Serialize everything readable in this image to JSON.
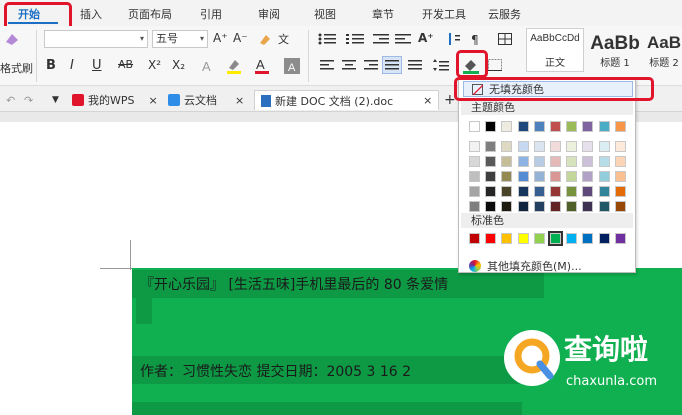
{
  "menu": {
    "tabs": [
      "开始",
      "插入",
      "页面布局",
      "引用",
      "审阅",
      "视图",
      "章节",
      "开发工具",
      "云服务"
    ],
    "active_tab": "开始"
  },
  "ribbon": {
    "format_painter_label": "格式刷",
    "font_size": "五号",
    "font_size_caret": "▾",
    "font_grow": "A⁺",
    "font_shrink": "A⁻",
    "bold": "B",
    "italic": "I",
    "underline": "U",
    "strikethrough": "AB",
    "superscript": "X²",
    "subscript": "X₂",
    "phonetic": "文",
    "styles": [
      {
        "sample": "AaBbCcDd",
        "label": "正文"
      },
      {
        "sample": "AaBb",
        "label": "标题 1"
      },
      {
        "sample": "AaB",
        "label": "标题 2"
      }
    ]
  },
  "doc_tabs": {
    "my_wps": "我的WPS",
    "cloud_docs": "云文档",
    "active_doc": "新建 DOC 文档 (2).doc",
    "close_glyph": "×",
    "add_glyph": "+"
  },
  "document": {
    "line1": "『开心乐园』 [生活五味]手机里最后的 80 条爱情",
    "line2": "作者：习惯性失恋   提交日期：2005 3 16 2"
  },
  "shading_dropdown": {
    "no_fill": "无填充颜色",
    "theme_colors_label": "主题颜色",
    "standard_colors_label": "标准色",
    "more_colors": "其他填充颜色(M)...",
    "theme_row": [
      "#ffffff",
      "#000000",
      "#eeece1",
      "#1f497d",
      "#4f81bd",
      "#c0504d",
      "#9bbb59",
      "#8064a2",
      "#4bacc6",
      "#f79646"
    ],
    "theme_shades": [
      [
        "#f2f2f2",
        "#7f7f7f",
        "#ddd9c3",
        "#c6d9f0",
        "#dbe5f1",
        "#f2dcdb",
        "#ebf1dd",
        "#e5e0ec",
        "#dbeef3",
        "#fdeada"
      ],
      [
        "#d8d8d8",
        "#595959",
        "#c4bd97",
        "#8db3e2",
        "#b8cce4",
        "#e5b9b7",
        "#d7e3bc",
        "#ccc1d9",
        "#b7dde8",
        "#fbd5b5"
      ],
      [
        "#bfbfbf",
        "#3f3f3f",
        "#938953",
        "#548dd4",
        "#95b3d7",
        "#d99694",
        "#c3d69b",
        "#b2a2c7",
        "#92cddc",
        "#fac08f"
      ],
      [
        "#a5a5a5",
        "#262626",
        "#494429",
        "#17365d",
        "#366092",
        "#953734",
        "#76923c",
        "#5f497a",
        "#31859b",
        "#e36c09"
      ],
      [
        "#7f7f7f",
        "#0c0c0c",
        "#1d1b10",
        "#0f243e",
        "#244061",
        "#632423",
        "#4f6128",
        "#3f3151",
        "#205867",
        "#974806"
      ]
    ],
    "standard_row": [
      "#c00000",
      "#ff0000",
      "#ffc000",
      "#ffff00",
      "#92d050",
      "#00b050",
      "#00b0f0",
      "#0070c0",
      "#002060",
      "#7030a0"
    ],
    "selected_standard": "#00b050"
  },
  "colors": {
    "accent": "#1d6fc4",
    "highlight_red": "#e0142a",
    "document_fill": "#10b050"
  },
  "watermark": {
    "text": "查询啦",
    "url": "chaxunla.com"
  }
}
